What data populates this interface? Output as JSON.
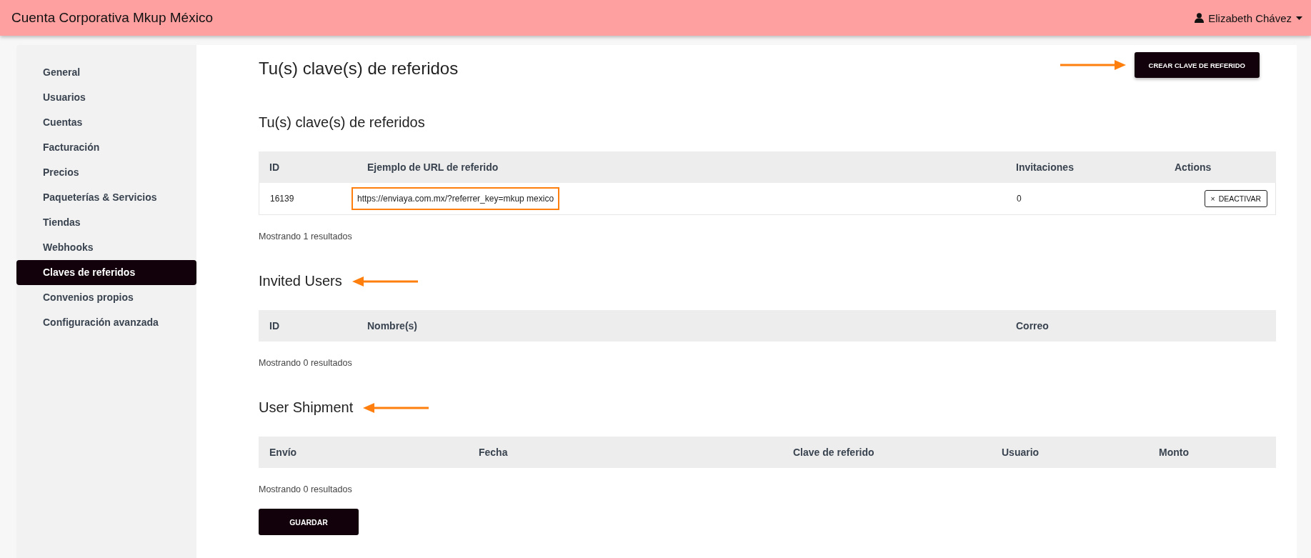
{
  "header": {
    "title": "Cuenta Corporativa Mkup México",
    "user": "Elizabeth Chávez"
  },
  "sidebar": {
    "items": [
      {
        "label": "General",
        "selected": false
      },
      {
        "label": "Usuarios",
        "selected": false
      },
      {
        "label": "Cuentas",
        "selected": false
      },
      {
        "label": "Facturación",
        "selected": false
      },
      {
        "label": "Precios",
        "selected": false
      },
      {
        "label": "Paqueterías & Servicios",
        "selected": false
      },
      {
        "label": "Tiendas",
        "selected": false
      },
      {
        "label": "Webhooks",
        "selected": false
      },
      {
        "label": "Claves de referidos",
        "selected": true
      },
      {
        "label": "Convenios propios",
        "selected": false
      },
      {
        "label": "Configuración avanzada",
        "selected": false
      }
    ]
  },
  "page_title": "Tu(s) clave(s) de referidos",
  "create_button": {
    "label": "CREAR CLAVE DE REFERIDO",
    "pointer_arrow": true
  },
  "sections": [
    {
      "title": "Tu(s) clave(s) de referidos",
      "pointer_arrow": false,
      "columns": [
        "ID",
        "Ejemplo de URL de referido",
        "Invitaciones",
        "Actions"
      ],
      "rows": [
        [
          {
            "kind": "text",
            "text": "16139"
          },
          {
            "kind": "boxed",
            "text": "https://enviaya.com.mx/?referrer_key=mkup mexico"
          },
          {
            "kind": "text",
            "text": "0"
          },
          {
            "kind": "button",
            "icon": "×",
            "text": "DEACTIVAR"
          }
        ]
      ],
      "footer": "Mostrando 1 resultados"
    },
    {
      "title": "Invited Users",
      "pointer_arrow": true,
      "columns": [
        "ID",
        "Nombre(s)",
        "Correo"
      ],
      "footer": "Mostrando 0 resultados"
    },
    {
      "title": "User Shipment",
      "pointer_arrow": true,
      "columns": [
        "Envío",
        "Fecha",
        "Clave de referido",
        "Usuario",
        "Monto"
      ],
      "footer": "Mostrando 0 resultados"
    }
  ],
  "save_button": "GUARDAR"
}
